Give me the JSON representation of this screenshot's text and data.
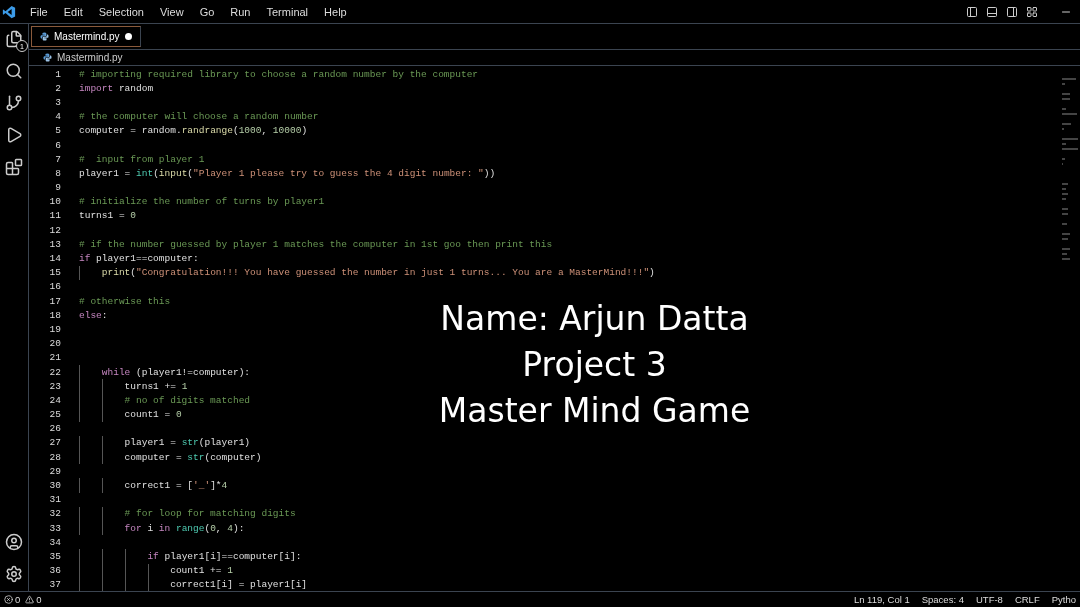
{
  "menu": [
    "File",
    "Edit",
    "Selection",
    "View",
    "Go",
    "Run",
    "Terminal",
    "Help"
  ],
  "activity_bar": {
    "explorer_badge": "1"
  },
  "tabs": [
    {
      "label": "Mastermind.py",
      "selected": true,
      "modified": true
    }
  ],
  "breadcrumb": "Mastermind.py",
  "code": [
    {
      "number": "1",
      "tokens": [
        {
          "kind": "comment",
          "text": "# importing required library to choose a random number by the computer"
        }
      ]
    },
    {
      "number": "2",
      "tokens": [
        {
          "kind": "keyword",
          "text": "import"
        },
        {
          "kind": "plain",
          "text": " random"
        }
      ]
    },
    {
      "number": "3"
    },
    {
      "number": "4",
      "tokens": [
        {
          "kind": "comment",
          "text": "# the computer will choose a random number"
        }
      ]
    },
    {
      "number": "5",
      "tokens": [
        {
          "kind": "plain",
          "text": "computer = random."
        },
        {
          "kind": "function",
          "text": "randrange"
        },
        {
          "kind": "plain",
          "text": "("
        },
        {
          "kind": "number",
          "text": "1000"
        },
        {
          "kind": "plain",
          "text": ", "
        },
        {
          "kind": "number",
          "text": "10000"
        },
        {
          "kind": "plain",
          "text": ")"
        }
      ]
    },
    {
      "number": "6"
    },
    {
      "number": "7",
      "tokens": [
        {
          "kind": "comment",
          "text": "#  input from player 1"
        }
      ]
    },
    {
      "number": "8",
      "tokens": [
        {
          "kind": "plain",
          "text": "player1 = "
        },
        {
          "kind": "builtin",
          "text": "int"
        },
        {
          "kind": "plain",
          "text": "("
        },
        {
          "kind": "function",
          "text": "input"
        },
        {
          "kind": "plain",
          "text": "("
        },
        {
          "kind": "string",
          "text": "\"Player 1 please try to guess the 4 digit number: \""
        },
        {
          "kind": "plain",
          "text": "))"
        }
      ]
    },
    {
      "number": "9"
    },
    {
      "number": "10",
      "tokens": [
        {
          "kind": "comment",
          "text": "# initialize the number of turns by player1"
        }
      ]
    },
    {
      "number": "11",
      "tokens": [
        {
          "kind": "plain",
          "text": "turns1 = "
        },
        {
          "kind": "number",
          "text": "0"
        }
      ]
    },
    {
      "number": "12"
    },
    {
      "number": "13",
      "tokens": [
        {
          "kind": "comment",
          "text": "# if the number guessed by player 1 matches the computer in 1st goo then print this"
        }
      ]
    },
    {
      "number": "14",
      "tokens": [
        {
          "kind": "keyword",
          "text": "if"
        },
        {
          "kind": "plain",
          "text": " player1==computer:"
        }
      ]
    },
    {
      "number": "15",
      "tokens": [
        {
          "kind": "function",
          "text": "    print"
        },
        {
          "kind": "plain",
          "text": "("
        },
        {
          "kind": "string",
          "text": "\"Congratulation!!! You have guessed the number in just 1 turns... You are a MasterMind!!!\""
        },
        {
          "kind": "plain",
          "text": ")"
        }
      ]
    },
    {
      "number": "16"
    },
    {
      "number": "17",
      "tokens": [
        {
          "kind": "comment",
          "text": "# otherwise this"
        }
      ]
    },
    {
      "number": "18",
      "tokens": [
        {
          "kind": "keyword",
          "text": "else"
        },
        {
          "kind": "plain",
          "text": ":"
        }
      ]
    },
    {
      "number": "19"
    },
    {
      "number": "20"
    },
    {
      "number": "21"
    },
    {
      "number": "22",
      "tokens": [
        {
          "kind": "keyword",
          "text": "    while"
        },
        {
          "kind": "plain",
          "text": " (player1!=computer):"
        }
      ]
    },
    {
      "number": "23",
      "tokens": [
        {
          "kind": "plain",
          "text": "        turns1 += "
        },
        {
          "kind": "number",
          "text": "1"
        }
      ]
    },
    {
      "number": "24",
      "tokens": [
        {
          "kind": "comment",
          "text": "        # no of digits matched"
        }
      ]
    },
    {
      "number": "25",
      "tokens": [
        {
          "kind": "plain",
          "text": "        count1 = "
        },
        {
          "kind": "number",
          "text": "0"
        }
      ]
    },
    {
      "number": "26"
    },
    {
      "number": "27",
      "tokens": [
        {
          "kind": "plain",
          "text": "        player1 = "
        },
        {
          "kind": "builtin",
          "text": "str"
        },
        {
          "kind": "plain",
          "text": "(player1)"
        }
      ]
    },
    {
      "number": "28",
      "tokens": [
        {
          "kind": "plain",
          "text": "        computer = "
        },
        {
          "kind": "builtin",
          "text": "str"
        },
        {
          "kind": "plain",
          "text": "(computer)"
        }
      ]
    },
    {
      "number": "29"
    },
    {
      "number": "30",
      "tokens": [
        {
          "kind": "plain",
          "text": "        correct1 = ["
        },
        {
          "kind": "string",
          "text": "'_'"
        },
        {
          "kind": "plain",
          "text": "]*"
        },
        {
          "kind": "number",
          "text": "4"
        }
      ]
    },
    {
      "number": "31"
    },
    {
      "number": "32",
      "tokens": [
        {
          "kind": "comment",
          "text": "        # for loop for matching digits"
        }
      ]
    },
    {
      "number": "33",
      "tokens": [
        {
          "kind": "keyword",
          "text": "        for"
        },
        {
          "kind": "plain",
          "text": " i "
        },
        {
          "kind": "keyword",
          "text": "in"
        },
        {
          "kind": "builtin",
          "text": " range"
        },
        {
          "kind": "plain",
          "text": "("
        },
        {
          "kind": "number",
          "text": "0"
        },
        {
          "kind": "plain",
          "text": ", "
        },
        {
          "kind": "number",
          "text": "4"
        },
        {
          "kind": "plain",
          "text": "):"
        }
      ]
    },
    {
      "number": "34"
    },
    {
      "number": "35",
      "tokens": [
        {
          "kind": "keyword",
          "text": "            if"
        },
        {
          "kind": "plain",
          "text": " player1[i]==computer[i]:"
        }
      ]
    },
    {
      "number": "36",
      "tokens": [
        {
          "kind": "plain",
          "text": "                count1 += "
        },
        {
          "kind": "number",
          "text": "1"
        }
      ]
    },
    {
      "number": "37",
      "tokens": [
        {
          "kind": "plain",
          "text": "                correct1[i] = player1[i]"
        }
      ]
    }
  ],
  "overlay": [
    "Name: Arjun Datta",
    "Project 3",
    "Master Mind Game"
  ],
  "status_bar": {
    "errors": "0",
    "warnings": "0",
    "items": [
      "Ln 119, Col 1",
      "Spaces: 4",
      "UTF-8",
      "CRLF",
      "Pytho"
    ]
  }
}
